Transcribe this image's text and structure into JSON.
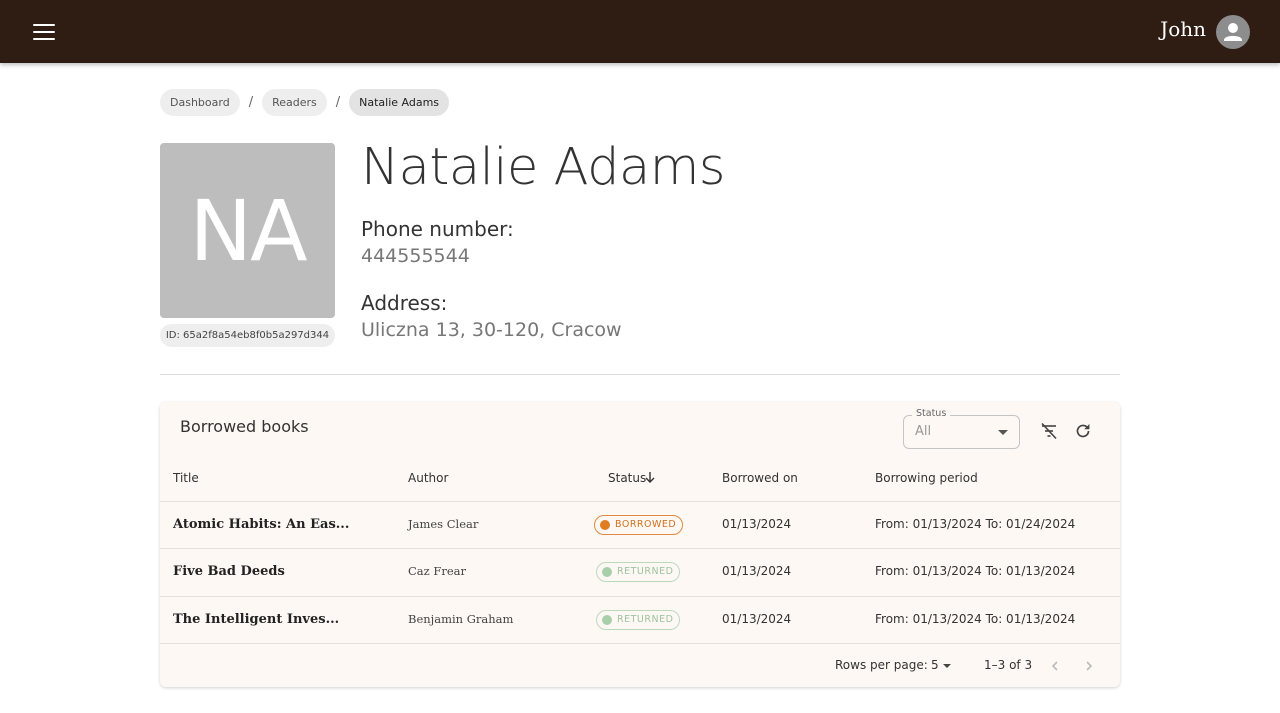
{
  "header": {
    "user_name": "John",
    "menu_icon": "menu-icon",
    "avatar_icon": "account-icon",
    "background": "#2f1c13"
  },
  "breadcrumb": [
    {
      "label": "Dashboard"
    },
    {
      "label": "Readers"
    },
    {
      "label": "Natalie Adams"
    }
  ],
  "breadcrumb_separator": "/",
  "reader": {
    "initials": "NA",
    "id_label": "ID: 65a2f8a54eb8f0b5a297d344",
    "name": "Natalie Adams",
    "phone_label": "Phone number:",
    "phone": "444555544",
    "address_label": "Address:",
    "address": "Uliczna 13, 30-120, Cracow"
  },
  "borrowed": {
    "title": "Borrowed books",
    "filter": {
      "label": "Status",
      "value": "All"
    },
    "clear_filter_icon": "filter-off-icon",
    "refresh_icon": "refresh-icon",
    "columns": [
      "Title",
      "Author",
      "Status",
      "Borrowed on",
      "Borrowing period"
    ],
    "sort_icon": "arrow-down-icon",
    "rows": [
      {
        "title": "Atomic Habits: An Eas...",
        "author": "James Clear",
        "status": "BORROWED",
        "borrowed_on": "01/13/2024",
        "period": "From: 01/13/2024 To: 01/24/2024"
      },
      {
        "title": "Five Bad Deeds",
        "author": "Caz Frear",
        "status": "RETURNED",
        "borrowed_on": "01/13/2024",
        "period": "From: 01/13/2024 To: 01/13/2024"
      },
      {
        "title": "The Intelligent Inves...",
        "author": "Benjamin Graham",
        "status": "RETURNED",
        "borrowed_on": "01/13/2024",
        "period": "From: 01/13/2024 To: 01/13/2024"
      }
    ],
    "footer": {
      "rows_per_page_label": "Rows per page:",
      "rows_per_page": "5",
      "range": "1–3 of 3"
    },
    "colors": {
      "borrowed": "#e07d22",
      "returned": "#a9cfa9",
      "card": "#fdf8f3"
    }
  }
}
